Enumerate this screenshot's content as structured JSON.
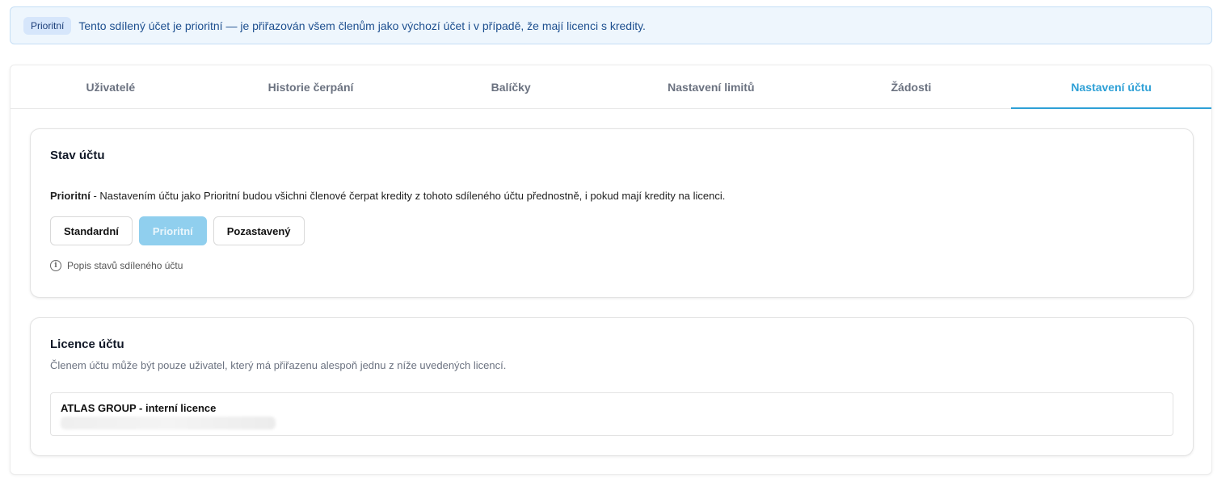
{
  "banner": {
    "badge": "Prioritní",
    "text": "Tento sdílený účet je prioritní — je přiřazován všem členům jako výchozí účet i v případě, že mají licenci s kredity."
  },
  "tabs": [
    {
      "label": "Uživatelé"
    },
    {
      "label": "Historie čerpání"
    },
    {
      "label": "Balíčky"
    },
    {
      "label": "Nastavení limitů"
    },
    {
      "label": "Žádosti"
    },
    {
      "label": "Nastavení účtu",
      "active": true
    }
  ],
  "account_state": {
    "title": "Stav účtu",
    "desc_strong": "Prioritní",
    "desc_rest": " - Nastavením účtu jako Prioritní budou všichni členové čerpat kredity z tohoto sdíleného účtu přednostně, i pokud mají kredity na licenci.",
    "buttons": [
      {
        "label": "Standardní"
      },
      {
        "label": "Prioritní",
        "active": true
      },
      {
        "label": "Pozastavený"
      }
    ],
    "help_link": "Popis stavů sdíleného účtu"
  },
  "licenses": {
    "title": "Licence účtu",
    "desc": "Členem účtu může být pouze uživatel, který má přiřazenu alespoň jednu z níže uvedených licencí.",
    "items": [
      {
        "name": "ATLAS GROUP - interní licence"
      }
    ]
  },
  "colors": {
    "accent": "#2ea0d6",
    "banner_bg": "#eef6fd",
    "active_button": "#90cfee"
  }
}
